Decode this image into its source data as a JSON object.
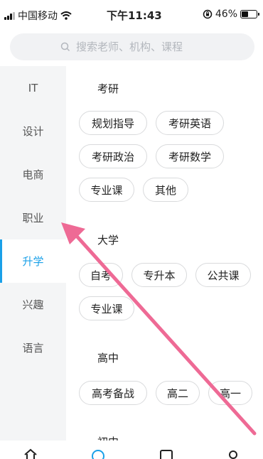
{
  "status_bar": {
    "carrier": "中国移动",
    "time": "下午11:43",
    "battery_text": "46%",
    "battery_level": 0.46
  },
  "search": {
    "placeholder": "搜索老师、机构、课程"
  },
  "sidebar": {
    "items": [
      {
        "label": "IT",
        "active": false
      },
      {
        "label": "设计",
        "active": false
      },
      {
        "label": "电商",
        "active": false
      },
      {
        "label": "职业",
        "active": false
      },
      {
        "label": "升学",
        "active": true
      },
      {
        "label": "兴趣",
        "active": false
      },
      {
        "label": "语言",
        "active": false
      }
    ],
    "accent_color": "#1aa0e8"
  },
  "sections": [
    {
      "title": "考研",
      "tags": [
        "规划指导",
        "考研英语",
        "考研政治",
        "考研数学",
        "专业课",
        "其他"
      ]
    },
    {
      "title": "大学",
      "tags": [
        "自考",
        "专升本",
        "公共课",
        "专业课"
      ]
    },
    {
      "title": "高中",
      "tags": [
        "高考备战",
        "高二",
        "高一"
      ]
    },
    {
      "title": "初中",
      "tags": []
    }
  ],
  "tabbar": {
    "icons": [
      "home-icon",
      "discover-icon",
      "study-icon",
      "profile-icon"
    ]
  },
  "annotation": {
    "arrow_color": "#ee6a95"
  }
}
